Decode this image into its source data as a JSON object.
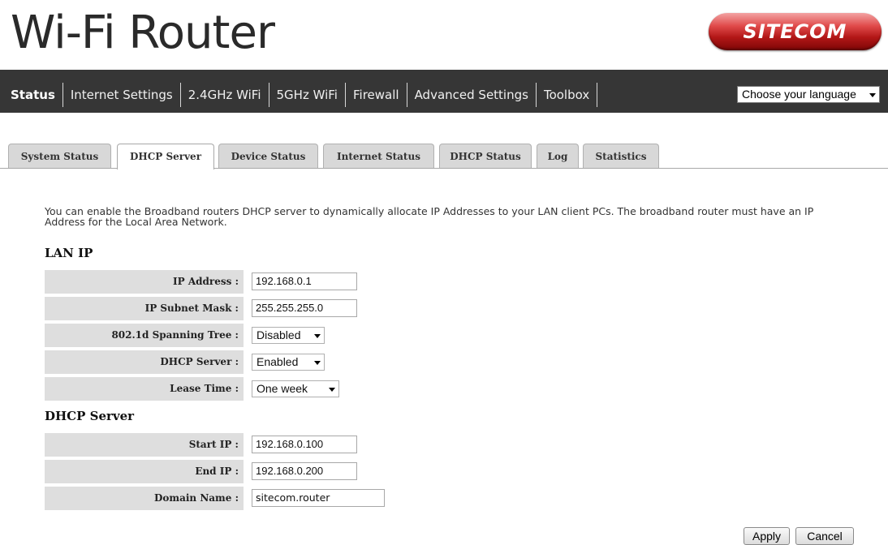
{
  "header": {
    "title": "Wi-Fi Router",
    "logo_text": "SITECOM"
  },
  "nav": {
    "items": [
      {
        "label": "Status",
        "active": true
      },
      {
        "label": "Internet Settings"
      },
      {
        "label": "2.4GHz WiFi"
      },
      {
        "label": "5GHz WiFi"
      },
      {
        "label": "Firewall"
      },
      {
        "label": "Advanced Settings"
      },
      {
        "label": "Toolbox"
      }
    ],
    "language_select": "Choose your language"
  },
  "tabs": [
    {
      "label": "System Status"
    },
    {
      "label": "DHCP Server",
      "active": true
    },
    {
      "label": "Device Status"
    },
    {
      "label": "Internet Status"
    },
    {
      "label": "DHCP Status"
    },
    {
      "label": "Log"
    },
    {
      "label": "Statistics"
    }
  ],
  "intro": "You can enable the Broadband routers DHCP server to dynamically allocate IP Addresses to your LAN client PCs. The broadband router must have an IP Address for the Local Area Network.",
  "lan": {
    "title": "LAN IP",
    "ip_address_label": "IP Address :",
    "ip_address": "192.168.0.1",
    "subnet_label": "IP Subnet Mask :",
    "subnet": "255.255.255.0",
    "spanning_label": "802.1d Spanning Tree :",
    "spanning": "Disabled",
    "dhcp_label": "DHCP Server :",
    "dhcp": "Enabled",
    "lease_label": "Lease Time :",
    "lease": "One week"
  },
  "dhcp": {
    "title": "DHCP Server",
    "start_label": "Start IP :",
    "start": "192.168.0.100",
    "end_label": "End IP :",
    "end": "192.168.0.200",
    "domain_label": "Domain Name :",
    "domain": "sitecom.router"
  },
  "buttons": {
    "apply": "Apply",
    "cancel": "Cancel"
  },
  "colors": {
    "navbar": "#363636",
    "brand_red": "#b31717",
    "label_bg": "#dedede"
  }
}
